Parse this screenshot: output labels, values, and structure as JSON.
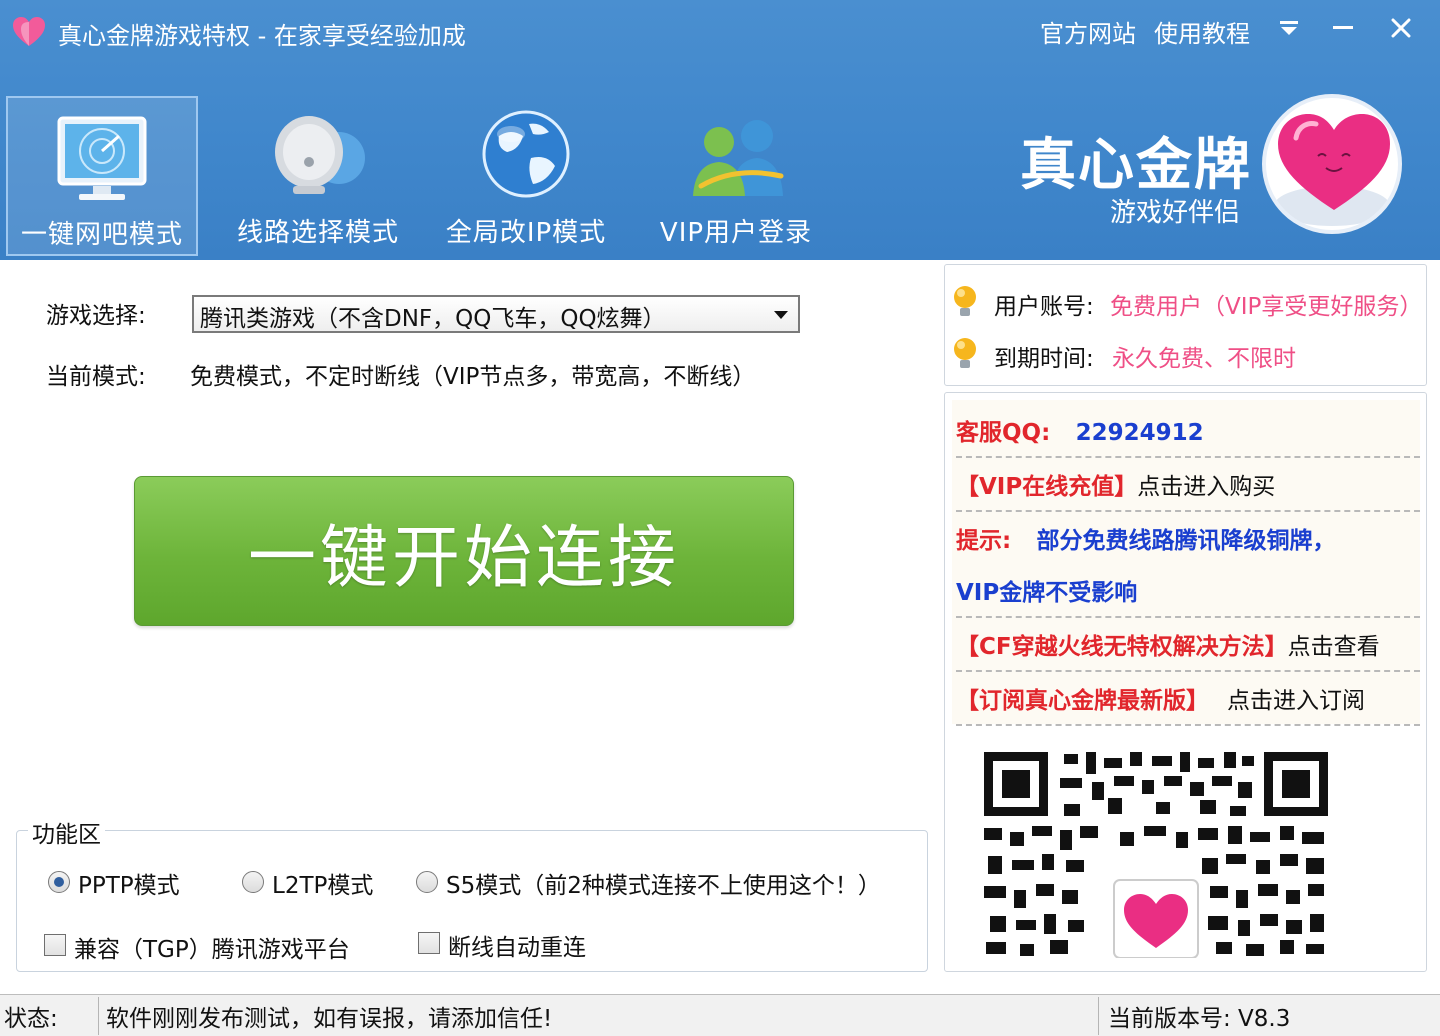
{
  "window": {
    "title": "真心金牌游戏特权 - 在家享受经验加成",
    "links": [
      "官方网站",
      "使用教程"
    ],
    "controls": {
      "menu": "▼",
      "minimize": "−",
      "close": "✕"
    }
  },
  "modes": [
    {
      "label": "一键网吧模式",
      "icon": "monitor-radar-icon",
      "active": true
    },
    {
      "label": "线路选择模式",
      "icon": "satellite-dish-icon",
      "active": false
    },
    {
      "label": "全局改IP模式",
      "icon": "globe-icon",
      "active": false
    },
    {
      "label": "VIP用户登录",
      "icon": "users-icon",
      "active": false
    }
  ],
  "brand": {
    "name": "真心金牌",
    "slogan": "游戏好伴侣",
    "logo": "heart-logo-icon"
  },
  "main": {
    "game_label": "游戏选择:",
    "game_selected": "腾讯类游戏（不含DNF，QQ飞车，QQ炫舞）",
    "mode_label": "当前模式:",
    "mode_value": "免费模式，不定时断线（VIP节点多，带宽高，不断线）",
    "connect_button": "一键开始连接"
  },
  "functions": {
    "legend": "功能区",
    "radios": [
      {
        "label": "PPTP模式",
        "checked": true
      },
      {
        "label": "L2TP模式",
        "checked": false
      },
      {
        "label": "S5模式（前2种模式连接不上使用这个！）",
        "checked": false
      }
    ],
    "checkboxes": [
      {
        "label": "兼容（TGP）腾讯游戏平台",
        "checked": false
      },
      {
        "label": "断线自动重连",
        "checked": false
      }
    ]
  },
  "account": {
    "account_label": "用户账号:",
    "account_value": "免费用户（VIP享受更好服务）",
    "expire_label": "到期时间:",
    "expire_value": "永久免费、不限时"
  },
  "info": {
    "qq_label": "客服QQ:",
    "qq_value": "22924912",
    "vip_recharge": "【VIP在线充值】",
    "vip_recharge_action": "点击进入购买",
    "tip_label": "提示:",
    "tip_text_1": "部分免费线路腾讯降级铜牌，",
    "tip_text_2": "VIP金牌不受影响",
    "cf_link": "【CF穿越火线无特权解决方法】",
    "cf_action": "点击查看",
    "subscribe_link": "【订阅真心金牌最新版】",
    "subscribe_action": "点击进入订阅"
  },
  "status": {
    "label": "状态:",
    "message": "软件刚刚发布测试，如有误报，请添加信任!",
    "version": "当前版本号: V8.3"
  },
  "colors": {
    "header_blue": "#4a8fd0",
    "connect_green": "#6db43a",
    "account_pink": "#ef4f86",
    "link_red": "#e1262c",
    "tip_blue": "#1a3fcf"
  }
}
